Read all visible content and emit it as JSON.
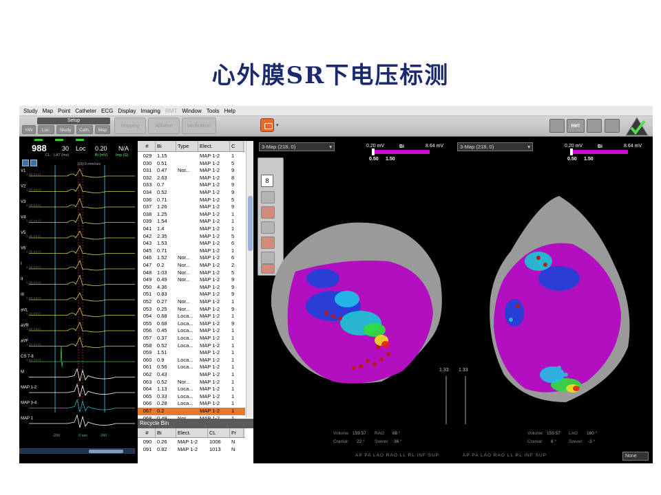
{
  "slide": {
    "title": "心外膜SR下电压标测"
  },
  "menu": [
    "Study",
    "Map",
    "Point",
    "Catheter",
    "ECG",
    "Display",
    "Imaging",
    "RMT",
    "Window",
    "Tools",
    "Help"
  ],
  "toolbar": {
    "setup": "Setup",
    "tabs": [
      "HW",
      "Loc.",
      "Study",
      "Cath.",
      "Map"
    ],
    "mapping": "Mapping",
    "ablation": "Ablation",
    "verification": "Verification",
    "rmt": "RMT"
  },
  "ecg": {
    "cl_value": "988",
    "cl_label": "CL",
    "lat_value": "30",
    "lat_label": "LAT (ms)",
    "loc_label": "Loc",
    "bi_value": "0.20",
    "bi_label": "Bi (mV)",
    "imp_value": "N/A",
    "imp_label": "Imp (Ω)",
    "sweep": "100.0 mm/sec",
    "channels": [
      {
        "name": "V1",
        "gain": "1.00 (mV)"
      },
      {
        "name": "V2",
        "gain": "1.00 (mV)"
      },
      {
        "name": "V3",
        "gain": "1.00 (mV)"
      },
      {
        "name": "V4",
        "gain": "1.00 (mV)"
      },
      {
        "name": "V5",
        "gain": "1.00 (mV)"
      },
      {
        "name": "V6",
        "gain": "1.00 (mV)"
      },
      {
        "name": "I",
        "gain": "1.00 (mV)"
      },
      {
        "name": "II",
        "gain": "1.00 (mV)"
      },
      {
        "name": "III",
        "gain": "1.00 (mV)"
      },
      {
        "name": "aVL",
        "gain": "1.00 (mV)"
      },
      {
        "name": "aVR",
        "gain": "1.00 (mV)"
      },
      {
        "name": "aVF",
        "gain": "1.10 (mV)"
      },
      {
        "name": "CS 7-8",
        "gain": "0.42 (mV)"
      },
      {
        "name": "M",
        "gain": ""
      },
      {
        "name": "MAP 1-2",
        "gain": ""
      },
      {
        "name": "MAP 3-4",
        "gain": ""
      },
      {
        "name": "MAP 1",
        "gain": ""
      }
    ],
    "markers": [
      "-200",
      "0 sec",
      "200"
    ]
  },
  "point_table": {
    "headers": [
      "#",
      "Bi",
      "Type",
      "Elect.",
      "C"
    ],
    "rows": [
      [
        "029",
        "1.15",
        "",
        "MAP 1-2",
        "1"
      ],
      [
        "030",
        "0.51",
        "",
        "MAP 1-2",
        "5"
      ],
      [
        "031",
        "0.47",
        "Nor...",
        "MAP 1-2",
        "9"
      ],
      [
        "032",
        "2.63",
        "",
        "MAP 1-2",
        "8"
      ],
      [
        "033",
        "0.7",
        "",
        "MAP 1-2",
        "9"
      ],
      [
        "034",
        "0.52",
        "",
        "MAP 1-2",
        "9"
      ],
      [
        "036",
        "0.71",
        "",
        "MAP 1-2",
        "5"
      ],
      [
        "037",
        "1.26",
        "",
        "MAP 1-2",
        "9"
      ],
      [
        "038",
        "1.25",
        "",
        "MAP 1-2",
        "1"
      ],
      [
        "039",
        "1.54",
        "",
        "MAP 1-2",
        "1"
      ],
      [
        "041",
        "1.4",
        "",
        "MAP 1-2",
        "1"
      ],
      [
        "042",
        "2.35",
        "",
        "MAP 1-2",
        "5"
      ],
      [
        "043",
        "1.53",
        "",
        "MAP 1-2",
        "6"
      ],
      [
        "045",
        "0.71",
        "",
        "MAP 1-2",
        "1"
      ],
      [
        "046",
        "1.52",
        "Nor...",
        "MAP 1-2",
        "6"
      ],
      [
        "047",
        "0.2",
        "Nor...",
        "MAP 1-2",
        "2"
      ],
      [
        "048",
        "1.03",
        "Nor...",
        "MAP 1-2",
        "5"
      ],
      [
        "049",
        "0.49",
        "Nor...",
        "MAP 1-2",
        "9"
      ],
      [
        "050",
        "4.36",
        "",
        "MAP 1-2",
        "9"
      ],
      [
        "051",
        "0.83",
        "",
        "MAP 1-2",
        "9"
      ],
      [
        "052",
        "0.27",
        "Nor...",
        "MAP 1-2",
        "1"
      ],
      [
        "053",
        "0.25",
        "Nor...",
        "MAP 1-2",
        "9"
      ],
      [
        "054",
        "0.68",
        "Loca...",
        "MAP 1-2",
        "1"
      ],
      [
        "055",
        "0.68",
        "Loca...",
        "MAP 1-2",
        "9"
      ],
      [
        "056",
        "0.45",
        "Loca...",
        "MAP 1-2",
        "1"
      ],
      [
        "057",
        "0.37",
        "Loca...",
        "MAP 1-2",
        "1"
      ],
      [
        "058",
        "0.52",
        "Loca...",
        "MAP 1-2",
        "1"
      ],
      [
        "059",
        "1.51",
        "",
        "MAP 1-2",
        "1"
      ],
      [
        "060",
        "0.9",
        "Loca...",
        "MAP 1-2",
        "1"
      ],
      [
        "061",
        "0.56",
        "Loca...",
        "MAP 1-2",
        "1"
      ],
      [
        "062",
        "0.43",
        "",
        "MAP 1-2",
        "1"
      ],
      [
        "063",
        "0.52",
        "Nor...",
        "MAP 1-2",
        "1"
      ],
      [
        "064",
        "1.13",
        "Loca...",
        "MAP 1-2",
        "1"
      ],
      [
        "065",
        "0.33",
        "Loca...",
        "MAP 1-2",
        "1"
      ],
      [
        "066",
        "0.28",
        "Loca...",
        "MAP 1-2",
        "1"
      ],
      [
        "067",
        "0.2",
        "",
        "MAP 1-2",
        "1"
      ],
      [
        "068",
        "0.49",
        "Nor...",
        "MAP 1-2",
        "1"
      ]
    ],
    "selected_index": 35
  },
  "recycle_bin": {
    "title": "Recycle Bin",
    "headers": [
      "#",
      "Bi",
      "Elect.",
      "CL",
      "Fr"
    ],
    "rows": [
      [
        "090",
        "0.26",
        "MAP 1-2",
        "1006",
        "N"
      ],
      [
        "091",
        "0.82",
        "MAP 1-2",
        "1013",
        "N"
      ]
    ]
  },
  "viewer_left": {
    "map_select": "3-Map (218, 0)",
    "scale_min": "0.20 mV",
    "scale_type": "Bi",
    "scale_max": "8.64 mV",
    "threshold_low": "0.50",
    "threshold_high": "1.50",
    "tool_number": "8",
    "zoom": "1.33",
    "volume_label": "Volume:",
    "volume": "159.57",
    "angle1_label": "RAO",
    "angle1": "88 °",
    "cranial_label": "Cranial:",
    "cranial": "22 °",
    "swivel_label": "Swivel:",
    "swivel": "36 °",
    "views": "AP  PA  LAO  RAO  LL  RL  INF  SUP"
  },
  "viewer_right": {
    "map_select": "3-Map (218, 0)",
    "scale_min": "0.20 mV",
    "scale_type": "Bi",
    "scale_max": "8.64 mV",
    "threshold_low": "0.50",
    "threshold_high": "1.50",
    "zoom": "1.33",
    "volume_label": "Volume:",
    "volume": "159.57",
    "angle1_label": "LAO",
    "angle1": "160 °",
    "cranial_label": "Cranial:",
    "cranial": "8 °",
    "swivel_label": "Swivel:",
    "swivel": "-3 °",
    "views": "AP  PA  LAO  RAO  LL  RL  INF  SUP",
    "dropdown": "None"
  },
  "colors": {
    "title": "#1b2a6e",
    "scar": "#b10fc0",
    "selected_row": "#e47a30",
    "ecg_trace": "#d7cf5a",
    "marker": "#2ab5c4"
  }
}
